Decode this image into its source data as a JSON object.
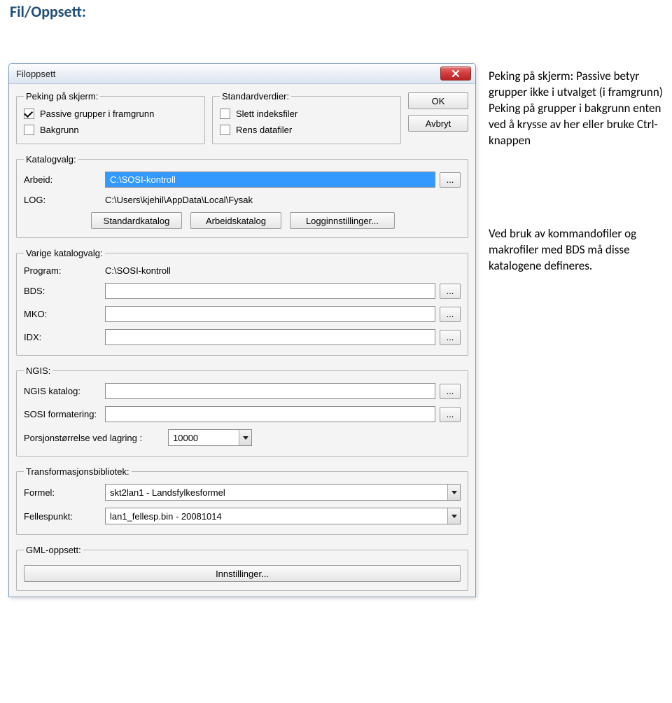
{
  "page_title": "Fil/Oppsett:",
  "dialog": {
    "window_title": "Filoppsett",
    "ok_label": "OK",
    "cancel_label": "Avbryt",
    "peking": {
      "legend": "Peking på skjerm:",
      "passive_label": "Passive grupper i framgrunn",
      "passive_checked": true,
      "bakgrunn_label": "Bakgrunn",
      "bakgrunn_checked": false
    },
    "standard": {
      "legend": "Standardverdier:",
      "slett_label": "Slett indeksfiler",
      "slett_checked": false,
      "rens_label": "Rens datafiler",
      "rens_checked": false
    },
    "katalog": {
      "legend": "Katalogvalg:",
      "arbeid_label": "Arbeid:",
      "arbeid_value": "C:\\SOSI-kontroll",
      "log_label": "LOG:",
      "log_value": "C:\\Users\\kjehil\\AppData\\Local\\Fysak",
      "btn_standard": "Standardkatalog",
      "btn_arbeid": "Arbeidskatalog",
      "btn_logg": "Logginnstillinger..."
    },
    "varige": {
      "legend": "Varige katalogvalg:",
      "program_label": "Program:",
      "program_value": "C:\\SOSI-kontroll",
      "bds_label": "BDS:",
      "bds_value": "",
      "mko_label": "MKO:",
      "mko_value": "",
      "idx_label": "IDX:",
      "idx_value": ""
    },
    "ngis": {
      "legend": "NGIS:",
      "katalog_label": "NGIS katalog:",
      "katalog_value": "",
      "format_label": "SOSI formatering:",
      "format_value": "",
      "porsjon_label": "Porsjonstørrelse ved lagring :",
      "porsjon_value": "10000"
    },
    "trans": {
      "legend": "Transformasjonsbibliotek:",
      "formel_label": "Formel:",
      "formel_value": "skt2lan1 - Landsfylkesformel",
      "felles_label": "Fellespunkt:",
      "felles_value": "lan1_fellesp.bin - 20081014"
    },
    "gml": {
      "legend": "GML-oppsett:",
      "btn": "Innstillinger..."
    }
  },
  "notes": {
    "p1": "Peking på skjerm: Passive betyr grupper ikke i utvalget (i framgrunn) Peking på grupper i bakgrunn enten ved å krysse av her eller bruke Ctrl-knappen",
    "p2": "Ved bruk av kommandofiler og makrofiler med BDS må disse katalogene defineres."
  }
}
